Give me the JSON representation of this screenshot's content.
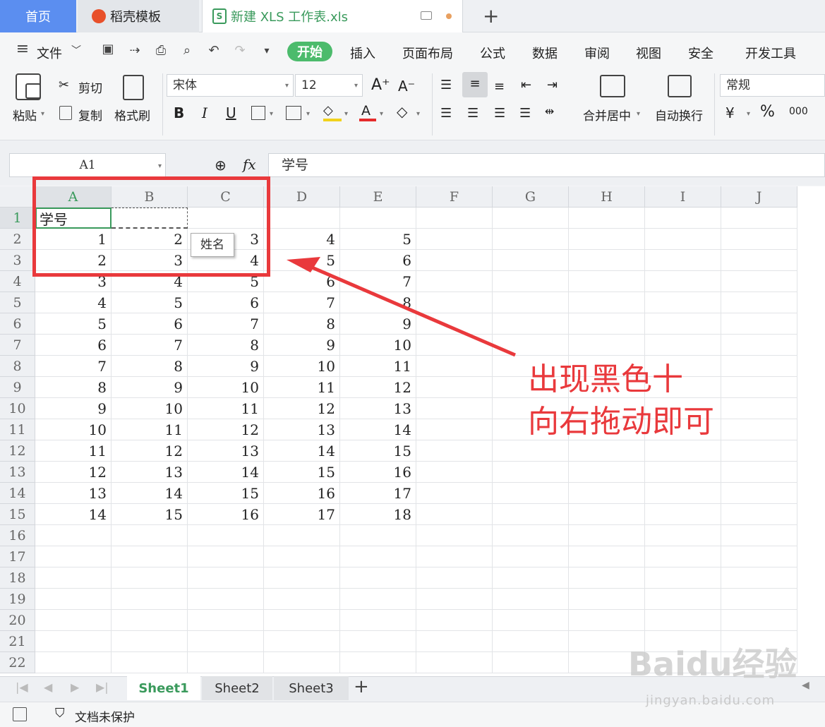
{
  "tabs": {
    "home": "首页",
    "template": "稻壳模板",
    "file": "新建 XLS 工作表.xls",
    "new_tab": "+"
  },
  "menu": {
    "file": "文件",
    "items": [
      "开始",
      "插入",
      "页面布局",
      "公式",
      "数据",
      "审阅",
      "视图",
      "安全",
      "开发工具"
    ]
  },
  "ribbon": {
    "paste": "粘贴",
    "cut": "剪切",
    "copy": "复制",
    "format_painter": "格式刷",
    "font_name": "宋体",
    "font_size": "12",
    "bold": "B",
    "italic": "I",
    "underline": "U",
    "merge_center": "合并居中",
    "wrap_text": "自动换行",
    "number_format": "常规",
    "percent": "%",
    "thousands": "000"
  },
  "formula_bar": {
    "name_box": "A1",
    "fx": "fx",
    "value": "学号"
  },
  "columns": [
    "A",
    "B",
    "C",
    "D",
    "E",
    "F",
    "G",
    "H",
    "I",
    "J"
  ],
  "rows": [
    "1",
    "2",
    "3",
    "4",
    "5",
    "6",
    "7",
    "8",
    "9",
    "10",
    "11",
    "12",
    "13",
    "14",
    "15",
    "16",
    "17",
    "18",
    "19",
    "20",
    "21",
    "22"
  ],
  "cell_a1": "学号",
  "table": [
    [
      "1",
      "2",
      "3",
      "4",
      "5"
    ],
    [
      "2",
      "3",
      "4",
      "5",
      "6"
    ],
    [
      "3",
      "4",
      "5",
      "6",
      "7"
    ],
    [
      "4",
      "5",
      "6",
      "7",
      "8"
    ],
    [
      "5",
      "6",
      "7",
      "8",
      "9"
    ],
    [
      "6",
      "7",
      "8",
      "9",
      "10"
    ],
    [
      "7",
      "8",
      "9",
      "10",
      "11"
    ],
    [
      "8",
      "9",
      "10",
      "11",
      "12"
    ],
    [
      "9",
      "10",
      "11",
      "12",
      "13"
    ],
    [
      "10",
      "11",
      "12",
      "13",
      "14"
    ],
    [
      "11",
      "12",
      "13",
      "14",
      "15"
    ],
    [
      "12",
      "13",
      "14",
      "15",
      "16"
    ],
    [
      "13",
      "14",
      "15",
      "16",
      "17"
    ],
    [
      "14",
      "15",
      "16",
      "17",
      "18"
    ]
  ],
  "tooltip": "姓名",
  "annotation": {
    "line1": "出现黑色十",
    "line2": "向右拖动即可"
  },
  "sheets": [
    "Sheet1",
    "Sheet2",
    "Sheet3"
  ],
  "add_sheet": "+",
  "status": {
    "protect": "文档未保护"
  },
  "watermark": {
    "brand": "Baidu经验",
    "url": "jingyan.baidu.com"
  },
  "colors": {
    "accent_green": "#4cbb6c",
    "annotation_red": "#e9393c",
    "home_tab_blue": "#5b8ef0"
  }
}
